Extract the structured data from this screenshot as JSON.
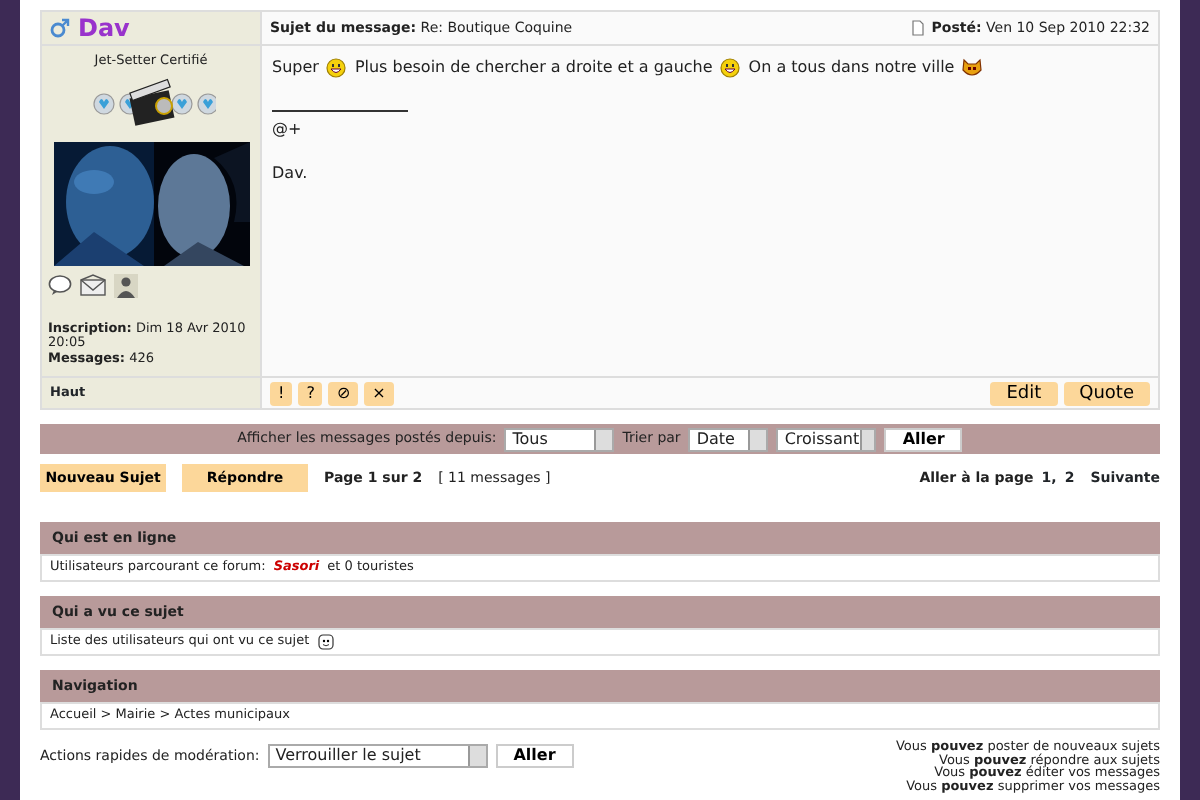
{
  "post": {
    "author": {
      "name": "Dav",
      "rank": "Jet-Setter Certifié",
      "joined_label": "Inscription:",
      "joined": "Dim 18 Avr 2010 20:05",
      "messages_label": "Messages:",
      "messages": "426"
    },
    "subject_label": "Sujet du message:",
    "subject": "Re: Boutique Coquine",
    "posted_label": "Posté:",
    "posted": "Ven 10 Sep 2010 22:32",
    "body": [
      {
        "kind": "text",
        "text": "Super"
      },
      {
        "kind": "smiley"
      },
      {
        "kind": "text",
        "text": "Plus besoin de chercher a droite et a gauche"
      },
      {
        "kind": "smiley"
      },
      {
        "kind": "text",
        "text": "On a tous dans notre ville"
      },
      {
        "kind": "devil"
      }
    ],
    "signature": [
      "@+",
      "Dav."
    ],
    "top_link": "Haut",
    "tools": [
      "!",
      "?",
      "⊘",
      "×"
    ],
    "buttons": [
      "Edit",
      "Quote"
    ]
  },
  "filter": {
    "label": "Afficher les messages postés depuis:",
    "sort_label": "Trier par",
    "selects": [
      "Tous",
      "Date",
      "Croissant"
    ],
    "button": "Aller"
  },
  "actions": {
    "buttons": [
      "Nouveau Sujet",
      "Répondre"
    ],
    "page_info": "Page 1 sur 2",
    "count": "[ 11 messages ]",
    "goto_label": "Aller à la page",
    "pages": [
      "1,",
      "2"
    ],
    "next": "Suivante"
  },
  "sections": [
    {
      "title": "Qui est en ligne",
      "kind": "online",
      "before": "Utilisateurs parcourant ce forum:",
      "user": "Sasori",
      "after": "et 0 touristes"
    },
    {
      "title": "Qui a vu ce sujet",
      "kind": "viewers",
      "text": "Liste des utilisateurs qui ont vu ce sujet"
    },
    {
      "title": "Navigation",
      "kind": "breadcrumb",
      "text": "Accueil > Mairie > Actes municipaux"
    }
  ],
  "moderation": {
    "label": "Actions rapides de modération:",
    "select": "Verrouiller le sujet",
    "button": "Aller"
  },
  "permissions": [
    "Vous **pouvez** poster de nouveaux sujets",
    "Vous **pouvez** répondre aux sujets",
    "Vous **pouvez** éditer vos messages",
    "Vous **pouvez** supprimer vos messages"
  ]
}
